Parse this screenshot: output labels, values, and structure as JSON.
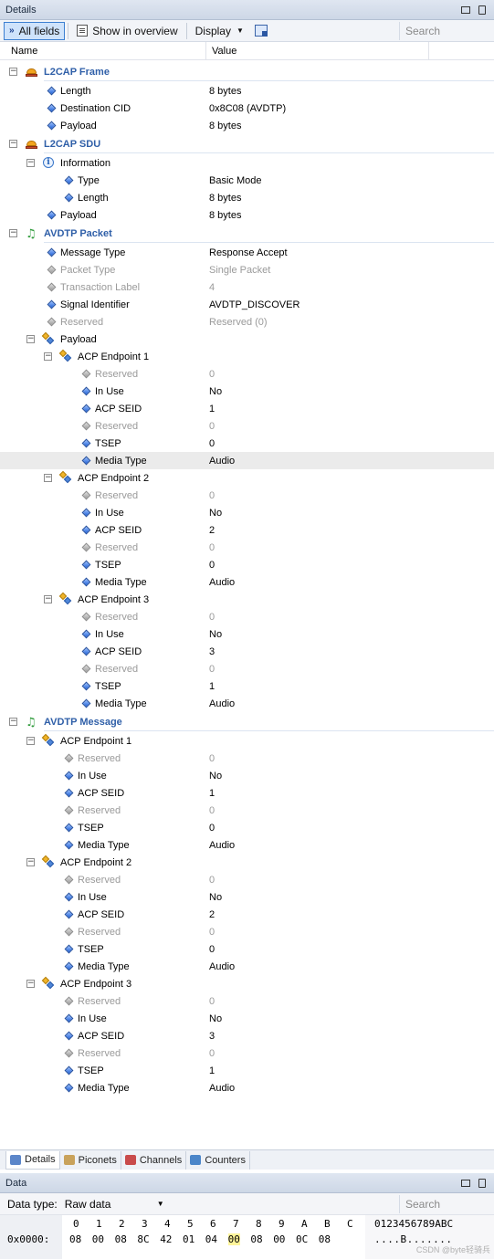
{
  "details_pane": {
    "title": "Details"
  },
  "toolbar": {
    "all_fields": "All fields",
    "show_in_overview": "Show in overview",
    "display": "Display",
    "search_placeholder": "Search"
  },
  "columns": {
    "name": "Name",
    "value": "Value"
  },
  "tree": [
    {
      "level": 0,
      "type": "section",
      "icon": "frame-icon",
      "name": "L2CAP Frame",
      "value": "",
      "expand": "minus"
    },
    {
      "level": 1,
      "type": "field",
      "name": "Length",
      "value": "8 bytes"
    },
    {
      "level": 1,
      "type": "field",
      "name": "Destination CID",
      "value": "0x8C08 (AVDTP)"
    },
    {
      "level": 1,
      "type": "field",
      "name": "Payload",
      "value": "8 bytes"
    },
    {
      "level": 0,
      "type": "section",
      "icon": "frame-icon",
      "name": "L2CAP SDU",
      "value": "",
      "expand": "minus"
    },
    {
      "level": 1,
      "type": "group",
      "icon": "info-icon",
      "name": "Information",
      "value": "",
      "expand": "minus"
    },
    {
      "level": 2,
      "type": "field",
      "name": "Type",
      "value": "Basic Mode"
    },
    {
      "level": 2,
      "type": "field",
      "name": "Length",
      "value": "8 bytes"
    },
    {
      "level": 1,
      "type": "field",
      "name": "Payload",
      "value": "8 bytes"
    },
    {
      "level": 0,
      "type": "section",
      "icon": "music-note-icon",
      "name": "AVDTP Packet",
      "value": "",
      "expand": "minus"
    },
    {
      "level": 1,
      "type": "field",
      "name": "Message Type",
      "value": "Response Accept"
    },
    {
      "level": 1,
      "type": "field",
      "dim": true,
      "name": "Packet Type",
      "value": "Single Packet"
    },
    {
      "level": 1,
      "type": "field",
      "dim": true,
      "name": "Transaction Label",
      "value": "4"
    },
    {
      "level": 1,
      "type": "field",
      "name": "Signal Identifier",
      "value": "AVDTP_DISCOVER"
    },
    {
      "level": 1,
      "type": "field",
      "dim": true,
      "name": "Reserved",
      "value": "Reserved (0)"
    },
    {
      "level": 1,
      "type": "group",
      "icon": "struct-icon",
      "name": "Payload",
      "value": "",
      "expand": "minus"
    },
    {
      "level": 2,
      "type": "group",
      "icon": "struct-icon",
      "name": "ACP Endpoint 1",
      "value": "",
      "expand": "minus"
    },
    {
      "level": 3,
      "type": "field",
      "dim": true,
      "name": "Reserved",
      "value": "0"
    },
    {
      "level": 3,
      "type": "field",
      "name": "In Use",
      "value": "No"
    },
    {
      "level": 3,
      "type": "field",
      "name": "ACP SEID",
      "value": "1"
    },
    {
      "level": 3,
      "type": "field",
      "dim": true,
      "name": "Reserved",
      "value": "0"
    },
    {
      "level": 3,
      "type": "field",
      "name": "TSEP",
      "value": "0"
    },
    {
      "level": 3,
      "type": "field",
      "selected": true,
      "name": "Media Type",
      "value": "Audio"
    },
    {
      "level": 2,
      "type": "group",
      "icon": "struct-icon",
      "name": "ACP Endpoint 2",
      "value": "",
      "expand": "minus"
    },
    {
      "level": 3,
      "type": "field",
      "dim": true,
      "name": "Reserved",
      "value": "0"
    },
    {
      "level": 3,
      "type": "field",
      "name": "In Use",
      "value": "No"
    },
    {
      "level": 3,
      "type": "field",
      "name": "ACP SEID",
      "value": "2"
    },
    {
      "level": 3,
      "type": "field",
      "dim": true,
      "name": "Reserved",
      "value": "0"
    },
    {
      "level": 3,
      "type": "field",
      "name": "TSEP",
      "value": "0"
    },
    {
      "level": 3,
      "type": "field",
      "name": "Media Type",
      "value": "Audio"
    },
    {
      "level": 2,
      "type": "group",
      "icon": "struct-icon",
      "name": "ACP Endpoint 3",
      "value": "",
      "expand": "minus"
    },
    {
      "level": 3,
      "type": "field",
      "dim": true,
      "name": "Reserved",
      "value": "0"
    },
    {
      "level": 3,
      "type": "field",
      "name": "In Use",
      "value": "No"
    },
    {
      "level": 3,
      "type": "field",
      "name": "ACP SEID",
      "value": "3"
    },
    {
      "level": 3,
      "type": "field",
      "dim": true,
      "name": "Reserved",
      "value": "0"
    },
    {
      "level": 3,
      "type": "field",
      "name": "TSEP",
      "value": "1"
    },
    {
      "level": 3,
      "type": "field",
      "name": "Media Type",
      "value": "Audio"
    },
    {
      "level": 0,
      "type": "section",
      "icon": "music-note-icon",
      "name": "AVDTP Message",
      "value": "",
      "expand": "minus"
    },
    {
      "level": 1,
      "type": "group",
      "icon": "struct-icon",
      "name": "ACP Endpoint 1",
      "value": "",
      "expand": "minus"
    },
    {
      "level": 2,
      "type": "field",
      "dim": true,
      "name": "Reserved",
      "value": "0"
    },
    {
      "level": 2,
      "type": "field",
      "name": "In Use",
      "value": "No"
    },
    {
      "level": 2,
      "type": "field",
      "name": "ACP SEID",
      "value": "1"
    },
    {
      "level": 2,
      "type": "field",
      "dim": true,
      "name": "Reserved",
      "value": "0"
    },
    {
      "level": 2,
      "type": "field",
      "name": "TSEP",
      "value": "0"
    },
    {
      "level": 2,
      "type": "field",
      "name": "Media Type",
      "value": "Audio"
    },
    {
      "level": 1,
      "type": "group",
      "icon": "struct-icon",
      "name": "ACP Endpoint 2",
      "value": "",
      "expand": "minus"
    },
    {
      "level": 2,
      "type": "field",
      "dim": true,
      "name": "Reserved",
      "value": "0"
    },
    {
      "level": 2,
      "type": "field",
      "name": "In Use",
      "value": "No"
    },
    {
      "level": 2,
      "type": "field",
      "name": "ACP SEID",
      "value": "2"
    },
    {
      "level": 2,
      "type": "field",
      "dim": true,
      "name": "Reserved",
      "value": "0"
    },
    {
      "level": 2,
      "type": "field",
      "name": "TSEP",
      "value": "0"
    },
    {
      "level": 2,
      "type": "field",
      "name": "Media Type",
      "value": "Audio"
    },
    {
      "level": 1,
      "type": "group",
      "icon": "struct-icon",
      "name": "ACP Endpoint 3",
      "value": "",
      "expand": "minus"
    },
    {
      "level": 2,
      "type": "field",
      "dim": true,
      "name": "Reserved",
      "value": "0"
    },
    {
      "level": 2,
      "type": "field",
      "name": "In Use",
      "value": "No"
    },
    {
      "level": 2,
      "type": "field",
      "name": "ACP SEID",
      "value": "3"
    },
    {
      "level": 2,
      "type": "field",
      "dim": true,
      "name": "Reserved",
      "value": "0"
    },
    {
      "level": 2,
      "type": "field",
      "name": "TSEP",
      "value": "1"
    },
    {
      "level": 2,
      "type": "field",
      "name": "Media Type",
      "value": "Audio"
    }
  ],
  "bottom_tabs": [
    {
      "label": "Details",
      "active": true
    },
    {
      "label": "Piconets",
      "active": false
    },
    {
      "label": "Channels",
      "active": false
    },
    {
      "label": "Counters",
      "active": false
    }
  ],
  "data_pane": {
    "title": "Data",
    "data_type_label": "Data type:",
    "data_type_value": "Raw data",
    "search_placeholder": "Search",
    "hex_columns": [
      "0",
      "1",
      "2",
      "3",
      "4",
      "5",
      "6",
      "7",
      "8",
      "9",
      "A",
      "B",
      "C"
    ],
    "ascii_header": "0123456789ABC",
    "rows": [
      {
        "offset": "0x0000:",
        "bytes": [
          "08",
          "00",
          "08",
          "8C",
          "42",
          "01",
          "04",
          "00",
          "08",
          "00",
          "0C",
          "08"
        ],
        "highlight_index": 7,
        "ascii": "....B......."
      }
    ]
  },
  "watermark": "CSDN @byte轻骑兵",
  "colors": {
    "section_text": "#2f5fa8",
    "selection_bg": "#ebebeb",
    "highlight": "#fff59a",
    "active_button_border": "#3c7fd1"
  }
}
